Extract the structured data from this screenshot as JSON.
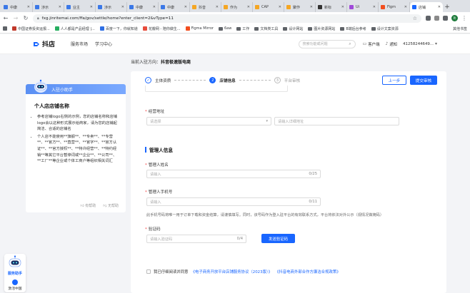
{
  "browser": {
    "tabs": [
      {
        "label": "中康",
        "color": "#3b78e7"
      },
      {
        "label": "涉示",
        "color": "#3b78e7"
      },
      {
        "label": "业主",
        "color": "#3b78e7"
      },
      {
        "label": "涉示",
        "color": "#3b78e7"
      },
      {
        "label": "中康",
        "color": "#3b78e7"
      },
      {
        "label": "中康",
        "color": "#3b78e7"
      },
      {
        "label": "抖音",
        "color": "#f5a623"
      },
      {
        "label": "作为",
        "color": "#f5a623"
      },
      {
        "label": "CAP",
        "color": "#f5a623"
      },
      {
        "label": "聚作",
        "color": "#f5a623"
      },
      {
        "label": "新标",
        "color": "#333333"
      },
      {
        "label": "Ui",
        "color": "#a04ad9"
      },
      {
        "label": "Figm",
        "color": "#f24e1e"
      },
      {
        "label": "店铺",
        "color": "#1966ff",
        "active": true
      }
    ],
    "url": "fxg.jinritemai.com/ffa/gov/settle/home?enter_client=2&vType=11",
    "new_tab": "+",
    "profile_initial": "lt",
    "bookmarks": [
      {
        "label": "中国证券投资运报...",
        "color": "#c0392b"
      },
      {
        "label": "人人都是产品经理 |...",
        "color": "#27ae60"
      },
      {
        "label": "百度一下，你就知道",
        "color": "#2f6fe4"
      },
      {
        "label": "花瓣网 - 陪你做生...",
        "color": "#e74c3c"
      },
      {
        "label": "Figma Mirror",
        "color": "#f24e1e"
      },
      {
        "label": "6aw",
        "folder": true
      },
      {
        "label": "工作",
        "folder": true
      },
      {
        "label": "文档类工具",
        "folder": true
      },
      {
        "label": "设计网站",
        "folder": true
      },
      {
        "label": "图片资源网站",
        "folder": true
      },
      {
        "label": "B端后台参考",
        "folder": true
      },
      {
        "label": "设计文案资源",
        "folder": true
      }
    ],
    "bookmarks_other": "其他书签"
  },
  "site": {
    "logo": "抖店",
    "nav": [
      "服务市场",
      "学习中心"
    ],
    "search_placeholder": "搜索功能或问题",
    "links": [
      "客户端",
      "通知",
      "41258244649..."
    ]
  },
  "entity": {
    "prefix": "当前入驻方向：",
    "value": "抖音极速版电商"
  },
  "assistant": {
    "header": "入驻小助手",
    "title": "个人店店铺名称",
    "items": [
      "参考店铺logo右侧的示例，您的店铺名称和店铺logo会以这种形式展示给商家，请为您的店铺起简洁、合适的店铺名",
      "个人店不能使用**旗舰**、**专卖**、**专营**、**官方**、**直营**、**官字**、**官方认证**、**官方授权**、**特许经营**、**特约经销**等其它平台暂停词或**企业**、**公司**、**工厂**等企业或个体工商户等组织相关词汇"
    ],
    "useful": "有帮助",
    "useless": "无帮助"
  },
  "steps": [
    {
      "num": "✓",
      "label": "主体资质",
      "state": "done"
    },
    {
      "num": "2",
      "label": "店铺信息",
      "state": "active"
    },
    {
      "num": "3",
      "label": "平台审核",
      "state": "todo"
    }
  ],
  "buttons": {
    "prev": "上一步",
    "submit": "提交审核",
    "send_code": "发送验证码"
  },
  "form": {
    "address_label": "经营地址",
    "address_select_placeholder": "请选择",
    "address_detail_placeholder": "请输入详细地址",
    "section_title": "管理人信息",
    "name_label": "管理人姓名",
    "name_placeholder": "请输入",
    "name_count": "0/25",
    "phone_label": "管理人手机号",
    "phone_placeholder": "请输入",
    "phone_count": "0/11",
    "phone_hint": "此手机号码将唯一用于订单下载和资金结算，请谨慎填写。同时，该号码作为登入驻平台的有效联系方式，平台将依法对外公示（视情况做掩码）",
    "code_label": "验证码",
    "code_placeholder": "请输入验证码",
    "code_count": "0/4"
  },
  "agreement": {
    "prefix": "我已仔细阅读并同意",
    "link1": "《电子商务开放平台店铺服务协议（2023版）》",
    "link2": "《抖音电商外部合作方廉洁合规政策》"
  },
  "float_help": {
    "title": "服务助手",
    "sub": "激活中国"
  },
  "colors": {
    "primary": "#1966ff",
    "required": "#f53f3f",
    "page_bg": "#f3f4f7"
  }
}
